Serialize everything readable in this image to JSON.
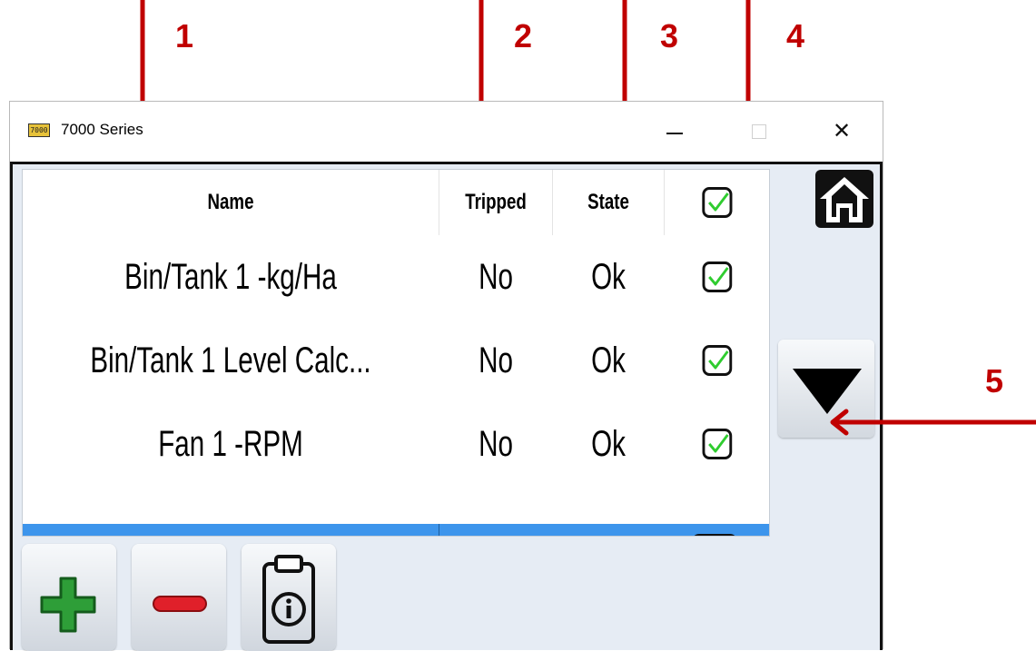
{
  "annotations": {
    "callout_1": "1",
    "callout_2": "2",
    "callout_3": "3",
    "callout_4": "4",
    "callout_5": "5",
    "arrow_color": "#c00000"
  },
  "window": {
    "title": "7000 Series",
    "app_icon_label": "7000",
    "close_glyph": "✕"
  },
  "table": {
    "headers": {
      "name": "Name",
      "tripped": "Tripped",
      "state": "State",
      "enabled_icon": "checkbox-checked-icon"
    },
    "rows": [
      {
        "name": "Bin/Tank 1 -kg/Ha",
        "tripped": "No",
        "state": "Ok",
        "enabled": true
      },
      {
        "name": "Bin/Tank 1 Level Calc...",
        "tripped": "No",
        "state": "Ok",
        "enabled": true
      },
      {
        "name": "Fan 1 -RPM",
        "tripped": "No",
        "state": "Ok",
        "enabled": true
      }
    ],
    "selected_row_color": "#3d95ec",
    "check_color": "#2fcc2f"
  },
  "side_buttons": {
    "home_icon": "home-icon",
    "scroll_icon": "triangle-down-icon"
  },
  "toolbar": {
    "add_icon": "plus-icon",
    "remove_icon": "minus-icon",
    "info_icon": "clipboard-info-icon"
  },
  "colors": {
    "client_background": "#e6ecf4",
    "add_green": "#2e9e38",
    "remove_red": "#e0202a"
  }
}
